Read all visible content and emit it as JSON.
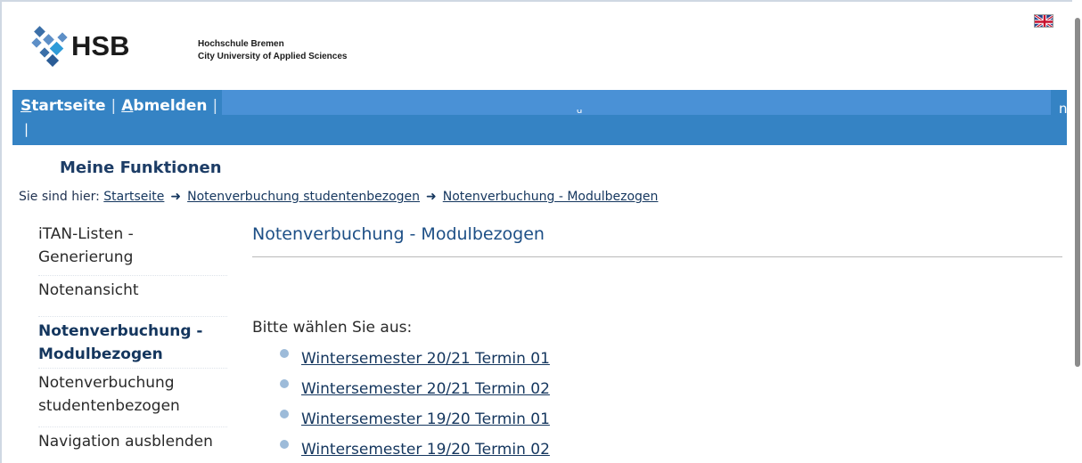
{
  "header": {
    "logo_text": "HSB",
    "uni_line1": "Hochschule Bremen",
    "uni_line2": "City University of Applied Sciences",
    "language_icon": "uk-flag-icon"
  },
  "nav": {
    "startseite_first": "S",
    "startseite_rest": "tartseite",
    "abmelden_first": "A",
    "abmelden_rest": "bmelden",
    "separator": "|",
    "second_row_pipe": "|",
    "fragment_right": "n"
  },
  "section_title": "Meine Funktionen",
  "breadcrumb": {
    "prefix": "Sie sind hier:",
    "arrow": "➜",
    "items": [
      "Startseite",
      "Notenverbuchung studentenbezogen",
      "Notenverbuchung - Modulbezogen"
    ]
  },
  "sidebar": {
    "items": [
      {
        "line1": "iTAN-Listen -",
        "line2": "Generierung"
      },
      {
        "line1": "Notenansicht",
        "line2": ""
      },
      {
        "line1": "Notenverbuchung -",
        "line2": "Modulbezogen"
      },
      {
        "line1": "Notenverbuchung",
        "line2": "studentenbezogen"
      },
      {
        "line1": "Navigation ausblenden",
        "line2": ""
      }
    ]
  },
  "content": {
    "title": "Notenverbuchung - Modulbezogen",
    "prompt": "Bitte wählen Sie aus:",
    "terms": [
      "Wintersemester 20/21 Termin 01",
      "Wintersemester 20/21 Termin 02",
      "Wintersemester 19/20 Termin 01",
      "Wintersemester 19/20 Termin 02"
    ]
  },
  "colors": {
    "navbar": "#3583c4",
    "accent_text": "#14365e",
    "bullet": "#9dbbd9"
  }
}
